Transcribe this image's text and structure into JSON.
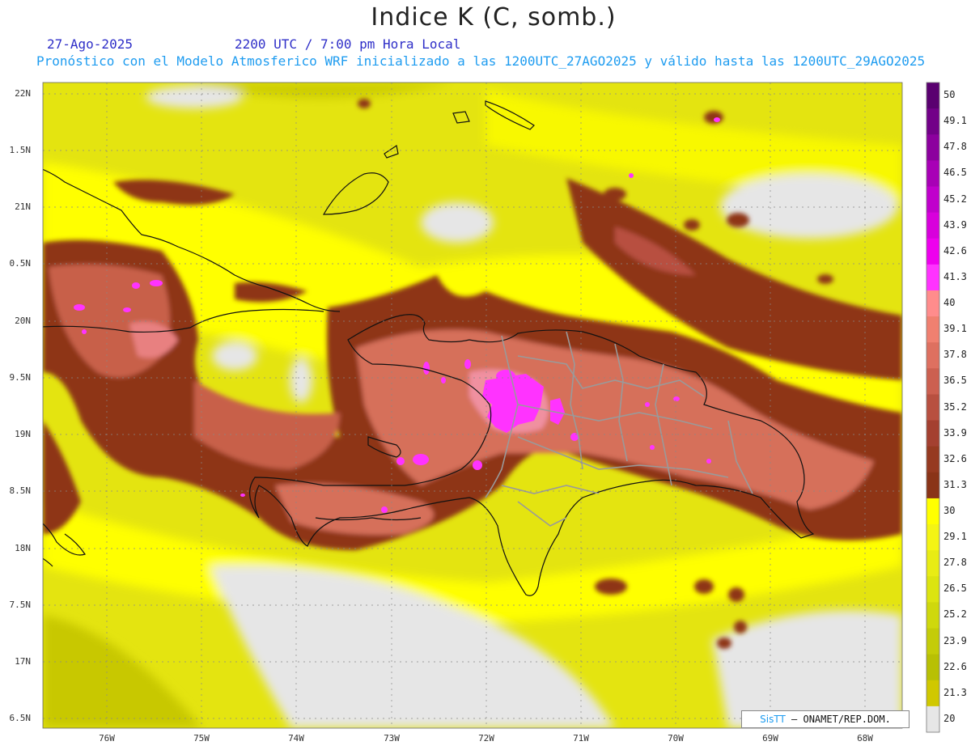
{
  "title": "Indice K (C, somb.)",
  "header": {
    "date": "27-Ago-2025",
    "time": "2200 UTC / 7:00 pm Hora Local",
    "subtitle": "Pronóstico con el Modelo Atmosferico WRF inicializado a las 1200UTC_27AGO2025 y válido hasta las  1200UTC_29AGO2025"
  },
  "axes": {
    "lat_labels": [
      "22N",
      "1.5N",
      "21N",
      "0.5N",
      "20N",
      "9.5N",
      "19N",
      "8.5N",
      "18N",
      "7.5N",
      "17N",
      "6.5N"
    ],
    "lon_labels": [
      "76W",
      "75W",
      "74W",
      "73W",
      "72W",
      "71W",
      "70W",
      "69W",
      "68W"
    ]
  },
  "colorbar": {
    "labels": [
      "50",
      "49.1",
      "47.8",
      "46.5",
      "45.2",
      "43.9",
      "42.6",
      "41.3",
      "40",
      "39.1",
      "37.8",
      "36.5",
      "35.2",
      "33.9",
      "32.6",
      "31.3",
      "30",
      "29.1",
      "27.8",
      "26.5",
      "25.2",
      "23.9",
      "22.6",
      "21.3",
      "20"
    ],
    "colors": [
      "#5a0070",
      "#720088",
      "#8c009e",
      "#a800b6",
      "#c000cc",
      "#d800dc",
      "#ee00ee",
      "#ff33ff",
      "#ff8c8c",
      "#f08070",
      "#de7060",
      "#cc6050",
      "#b85040",
      "#a44030",
      "#963a20",
      "#8a3418",
      "#ffff00",
      "#f4f414",
      "#e8ec14",
      "#dce410",
      "#cfd80c",
      "#c4cc08",
      "#b8c004",
      "#d0c800",
      "#e6e6e6"
    ]
  },
  "credit": {
    "brand": "SisTT",
    "text": " – ONAMET/REP.DOM."
  }
}
